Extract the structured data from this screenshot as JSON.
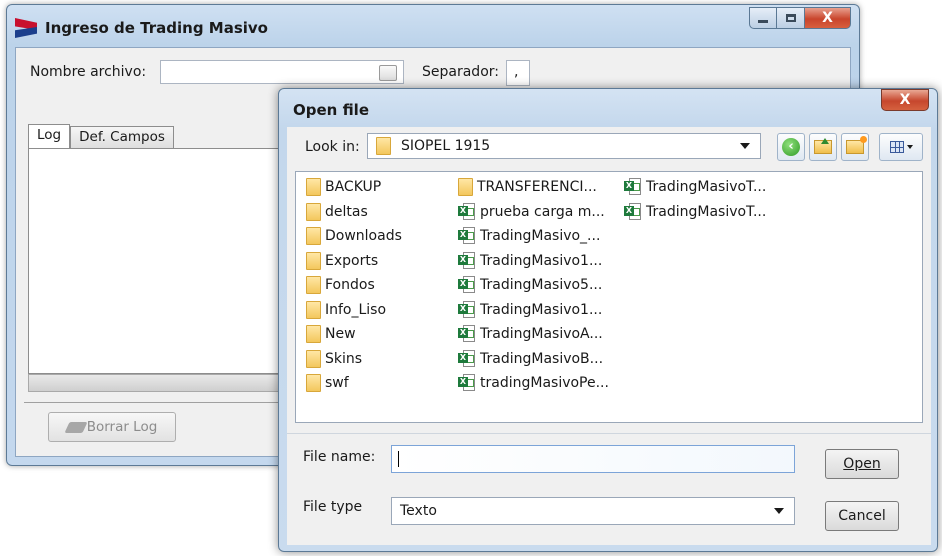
{
  "main_window": {
    "title": "Ingreso de Trading Masivo",
    "nombre_label": "Nombre archivo:",
    "nombre_value": "",
    "separador_label": "Separador:",
    "separador_value": ",",
    "tabs": [
      {
        "label": "Log",
        "active": true
      },
      {
        "label": "Def. Campos",
        "active": false
      }
    ],
    "borrar_label": "Borrar Log",
    "caption": {
      "minimize": "—",
      "maximize": "▢",
      "close": "X"
    }
  },
  "dialog": {
    "title": "Open file",
    "close": "X",
    "look_in_label": "Look in:",
    "look_in_value": "SIOPEL 1915",
    "files_col1": [
      {
        "name": "BACKUP",
        "icon": "folder-icon"
      },
      {
        "name": "deltas",
        "icon": "folder-icon"
      },
      {
        "name": "Downloads",
        "icon": "folder-icon"
      },
      {
        "name": "Exports",
        "icon": "folder-icon"
      },
      {
        "name": "Fondos",
        "icon": "folder-icon"
      },
      {
        "name": "Info_Liso",
        "icon": "folder-icon"
      },
      {
        "name": "New",
        "icon": "folder-icon"
      },
      {
        "name": "Skins",
        "icon": "folder-icon"
      },
      {
        "name": "swf",
        "icon": "folder-icon"
      }
    ],
    "files_col2": [
      {
        "name": "TRANSFERENCI...",
        "icon": "folder-icon"
      },
      {
        "name": "prueba carga m...",
        "icon": "excel-file-icon"
      },
      {
        "name": "TradingMasivo_...",
        "icon": "excel-file-icon"
      },
      {
        "name": "TradingMasivo1...",
        "icon": "excel-file-icon"
      },
      {
        "name": "TradingMasivo5...",
        "icon": "excel-file-icon"
      },
      {
        "name": "TradingMasivo1...",
        "icon": "excel-file-icon"
      },
      {
        "name": "TradingMasivoA...",
        "icon": "excel-file-icon"
      },
      {
        "name": "TradingMasivoB...",
        "icon": "excel-file-icon"
      },
      {
        "name": "tradingMasivoPe...",
        "icon": "excel-file-icon"
      }
    ],
    "files_col3": [
      {
        "name": "TradingMasivoT...",
        "icon": "excel-file-icon"
      },
      {
        "name": "TradingMasivoT...",
        "icon": "excel-file-icon"
      }
    ],
    "file_name_label": "File name:",
    "file_name_value": "",
    "file_type_label": "File type",
    "file_type_value": "Texto",
    "open_label": "Open",
    "cancel_label": "Cancel"
  }
}
